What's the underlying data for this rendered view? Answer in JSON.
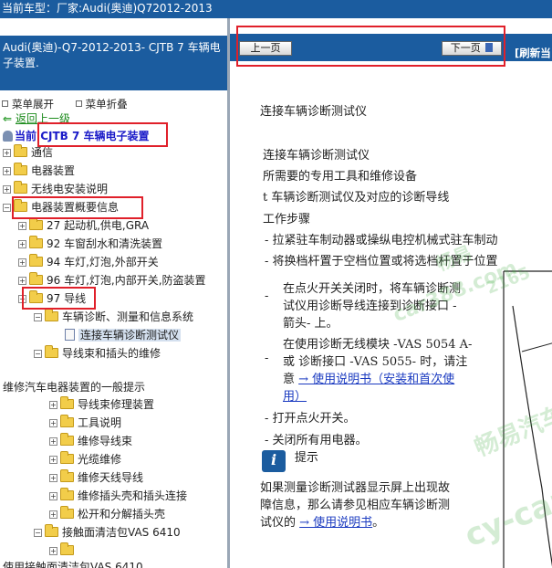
{
  "topbar": {
    "label": "当前车型：厂家:Audi(奥迪)Q72012-2013"
  },
  "sidebar": {
    "heading": "Audi(奥迪)-Q7-2012-2013- CJTB 7 车辆电子装置.",
    "expand_label": "菜单展开",
    "collapse_label": "菜单折叠",
    "back_label": "返回上一级",
    "current_prefix": "当前",
    "current_label": "CJTB 7 车辆电子装置",
    "items": [
      {
        "label": "通信"
      },
      {
        "label": "电器装置"
      },
      {
        "label": "无线电安装说明"
      },
      {
        "label": "电器装置概要信息"
      },
      {
        "label": "27 起动机,供电,GRA"
      },
      {
        "label": "92 车窗刮水和清洗装置"
      },
      {
        "label": "94 车灯,灯泡,外部开关"
      },
      {
        "label": "96 车灯,灯泡,内部开关,防盗装置"
      },
      {
        "label": "97 导线"
      },
      {
        "label": "车辆诊断、测量和信息系统"
      },
      {
        "label": "连接车辆诊断测试仪"
      },
      {
        "label": "导线束和插头的维修"
      },
      {
        "label": "维修汽车电器装置的一般提示"
      },
      {
        "label": "导线束修理装置"
      },
      {
        "label": "工具说明"
      },
      {
        "label": "维修导线束"
      },
      {
        "label": "光缆维修"
      },
      {
        "label": "维修天线导线"
      },
      {
        "label": "维修插头壳和插头连接"
      },
      {
        "label": "松开和分解插头壳"
      },
      {
        "label": "接触面清洁包VAS 6410"
      },
      {
        "label": ""
      },
      {
        "label": "使用接触面清洁包VAS 6410"
      }
    ]
  },
  "toolbar": {
    "prev_label": "上一页",
    "next_label": "下一页",
    "refresh_label": "[刷新当"
  },
  "doc": {
    "title": "连接车辆诊断测试仪",
    "subtitle": "连接车辆诊断测试仪",
    "tools_heading": "所需要的专用工具和维修设备",
    "tool_item": "t  车辆诊断测试仪及对应的诊断导线",
    "steps_heading": "工作步骤",
    "step1": "-   拉紧驻车制动器或操纵电控机械式驻车制动",
    "step2": "-   将换档杆置于空档位置或将选档杆置于位置",
    "step3_line1": "在点火开关关闭时，将车辆诊断测",
    "step3_line2": "试仪用诊断导线连接到诊断接口 -",
    "step3_line3": "箭头- 上。",
    "step4_line1": "在使用诊断无线模块  -VAS 5054 A-",
    "step4_line2": "或  诊断接口  -VAS 5055- 时，请注",
    "step4_line3_prefix": "意 ",
    "step4_link": "→ 使用说明书（安装和首次使",
    "step4_link2": "用）",
    "step5": "-   打开点火开关。",
    "step6": "-   关闭所有用电器。",
    "tip_heading": "提示",
    "tip_line1": "如果测量诊断测试器显示屏上出现故",
    "tip_line2": "障信息，那么请参见相应车辆诊断测",
    "tip_line3_prefix": "试仪的 ",
    "tip_link": "→ 使用说明书",
    "tip_suffix": "。",
    "dash": "-",
    "info_glyph": "i"
  },
  "watermarks": [
    "畅易",
    "car388.com",
    "2165",
    "畅易汽车",
    "cy-car"
  ]
}
